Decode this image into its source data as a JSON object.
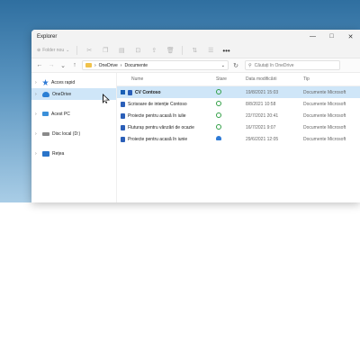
{
  "window": {
    "title": "Explorer",
    "controls": [
      "—",
      "□",
      "✕"
    ]
  },
  "toolbar": {
    "new_label": "Folder nou",
    "more": "•••"
  },
  "address": {
    "crumbs": [
      "OneDrive",
      "Documente"
    ],
    "separator": "›"
  },
  "search": {
    "placeholder": "Căutați în OneDrive"
  },
  "sidebar": {
    "items": [
      {
        "label": "Acces rapid",
        "icon": "star-icon"
      },
      {
        "label": "OneDrive",
        "icon": "cloud-icon",
        "selected": true
      },
      {
        "label": "Acest PC",
        "icon": "pc-icon"
      },
      {
        "label": "Disc local (D:)",
        "icon": "disk-icon"
      },
      {
        "label": "Rețea",
        "icon": "network-icon"
      }
    ]
  },
  "file_list": {
    "columns": [
      "Nume",
      "Stare",
      "Data modificării",
      "Tip"
    ],
    "rows": [
      {
        "name": "CV Contoso",
        "date": "19/8/2021 15:03",
        "type": "Documente Microsoft",
        "status": "sync-ok",
        "selected": true
      },
      {
        "name": "Scrisoare de intenție Contoso",
        "date": "8/8/2021 10:58",
        "type": "Documente Microsoft",
        "status": "sync-ok"
      },
      {
        "name": "Proiecte pentru acasă în iulie",
        "date": "22/7/2021 20:41",
        "type": "Documente Microsoft",
        "status": "sync-ok"
      },
      {
        "name": "Fluturaș pentru vânzări de ocazie",
        "date": "16/7/2021 9:07",
        "type": "Documente Microsoft",
        "status": "sync-ok"
      },
      {
        "name": "Proiecte pentru acasă în iunie",
        "date": "29/6/2021 12:05",
        "type": "Documente Microsoft",
        "status": "cloud"
      }
    ]
  },
  "colors": {
    "selection": "#cfe6f8",
    "accent": "#1a5fb4",
    "sync_ok": "#2f9e44"
  }
}
